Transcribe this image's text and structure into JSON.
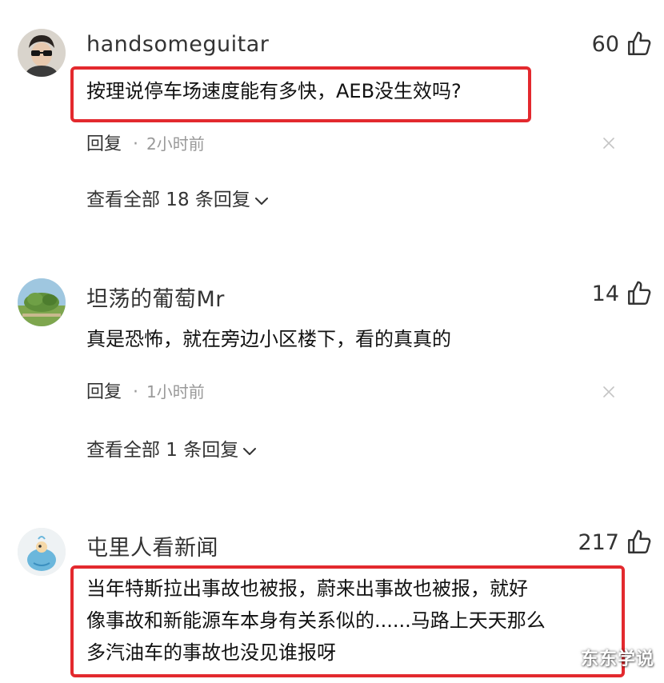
{
  "comments": [
    {
      "username": "handsomeguitar",
      "likes": "60",
      "lines": [
        "按理说停车场速度能有多快，AEB没生效吗?"
      ],
      "highlighted": true,
      "reply_label": "回复",
      "dot": "·",
      "time": "2小时前",
      "view_replies": "查看全部 18 条回复"
    },
    {
      "username": "坦荡的葡萄Mr",
      "likes": "14",
      "lines": [
        "真是恐怖，就在旁边小区楼下，看的真真的"
      ],
      "highlighted": false,
      "reply_label": "回复",
      "dot": "·",
      "time": "1小时前",
      "view_replies": "查看全部 1 条回复"
    },
    {
      "username": "屯里人看新闻",
      "likes": "217",
      "lines": [
        "当年特斯拉出事故也被报，蔚来出事故也被报，就好",
        "像事故和新能源车本身有关系似的......马路上天天那么",
        "多汽油车的事故也没见谁报呀"
      ],
      "highlighted": true
    }
  ],
  "watermark": "东东学说",
  "icons": {
    "like": "thumbs-up-icon",
    "close": "close-icon",
    "expand": "chevron-down-icon"
  },
  "colors": {
    "highlight_border": "#e3292e",
    "meta_text": "#999999",
    "primary_text": "#111111"
  }
}
